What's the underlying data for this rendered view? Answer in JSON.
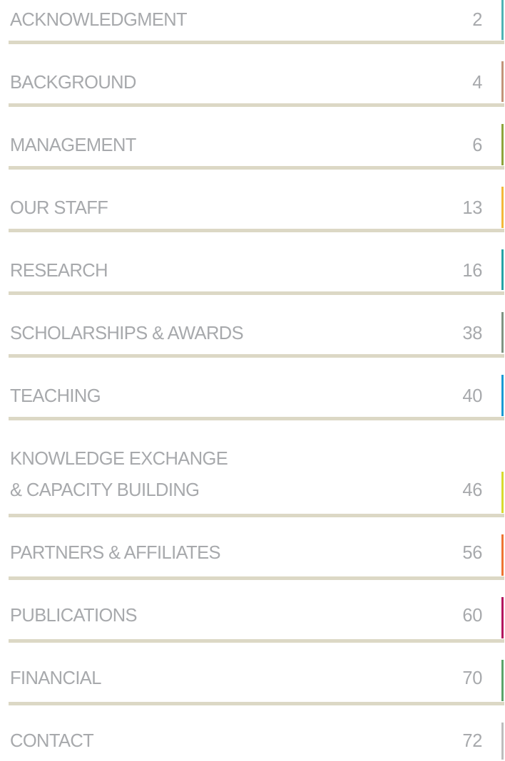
{
  "theme": {
    "text_color": "#a7a9ac",
    "rule_color": "#dcd8c5"
  },
  "toc": {
    "entries": [
      {
        "lines": [
          "ACKNOWLEDGMENT"
        ],
        "page": "2",
        "accent": "#4fb3b4"
      },
      {
        "lines": [
          "BACKGROUND"
        ],
        "page": "4",
        "accent": "#c29479"
      },
      {
        "lines": [
          "MANAGEMENT"
        ],
        "page": "6",
        "accent": "#8ea43c"
      },
      {
        "lines": [
          "OUR STAFF"
        ],
        "page": "13",
        "accent": "#f2b83a"
      },
      {
        "lines": [
          "RESEARCH"
        ],
        "page": "16",
        "accent": "#25a3a6"
      },
      {
        "lines": [
          "SCHOLARSHIPS & AWARDS"
        ],
        "page": "38",
        "accent": "#7f9482"
      },
      {
        "lines": [
          "TEACHING"
        ],
        "page": "40",
        "accent": "#1a9ad3"
      },
      {
        "lines": [
          "KNOWLEDGE EXCHANGE",
          "& CAPACITY BUILDING"
        ],
        "page": "46",
        "accent": "#d7db2f"
      },
      {
        "lines": [
          "PARTNERS & AFFILIATES"
        ],
        "page": "56",
        "accent": "#ee7433"
      },
      {
        "lines": [
          "PUBLICATIONS"
        ],
        "page": "60",
        "accent": "#b3135e"
      },
      {
        "lines": [
          "FINANCIAL"
        ],
        "page": "70",
        "accent": "#5aa46a"
      },
      {
        "lines": [
          "CONTACT"
        ],
        "page": "72",
        "accent": "#bdbdbd"
      }
    ]
  }
}
